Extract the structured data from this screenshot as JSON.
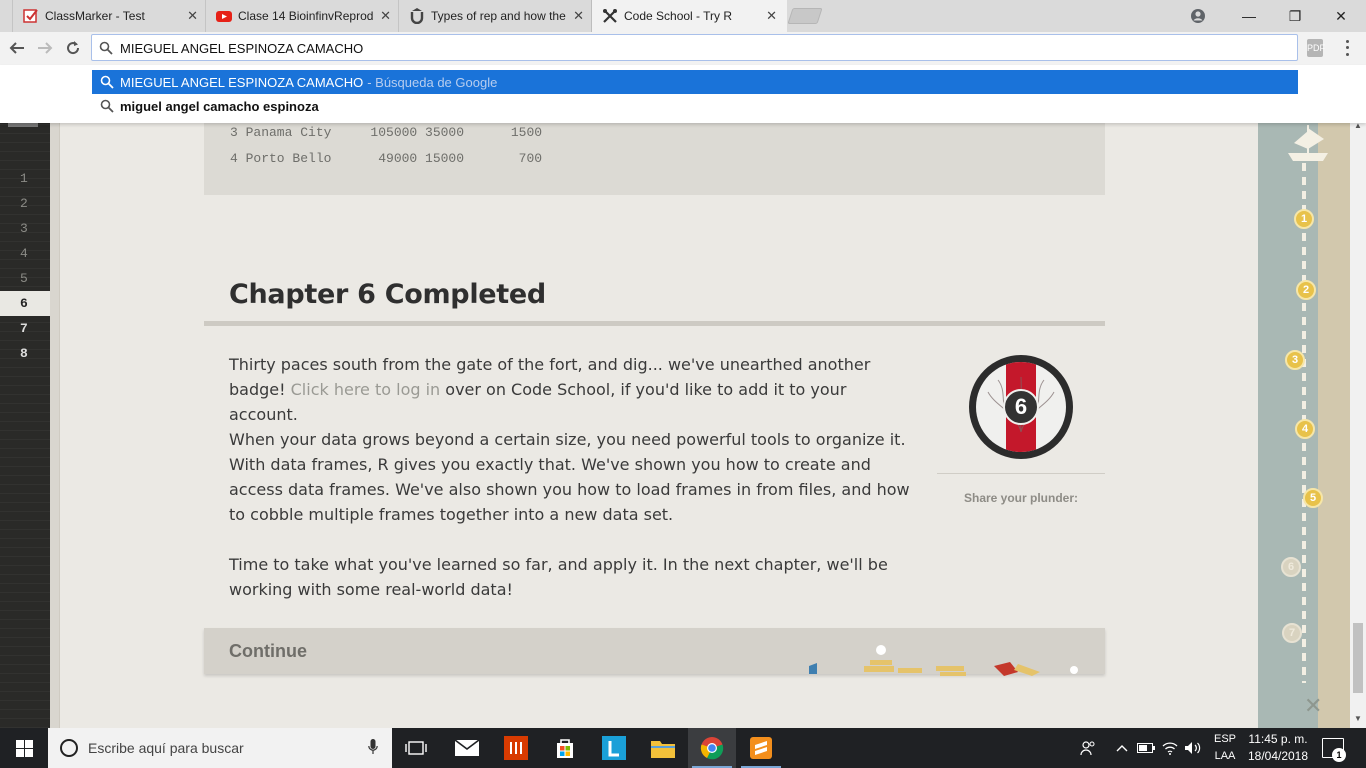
{
  "browser": {
    "tabs": [
      {
        "title": "ClassMarker - Test",
        "icon": "classmarker-icon",
        "active": false
      },
      {
        "title": "Clase 14 BioinfinvReprod",
        "icon": "youtube-icon",
        "active": false
      },
      {
        "title": "Types of rep and how the",
        "icon": "udemy-icon",
        "active": false
      },
      {
        "title": "Code School - Try R",
        "icon": "codeschool-icon",
        "active": true
      }
    ],
    "close_glyph": "✕",
    "address": "MIEGUEL ANGEL ESPINOZA CAMACHO",
    "window_controls": {
      "minimize": "—",
      "restore": "❐",
      "close": "✕"
    },
    "extension_label": "PDF",
    "suggestions": [
      {
        "text": "MIEGUEL ANGEL ESPINOZA CAMACHO",
        "sub": "- Búsqueda de Google",
        "selected": true
      },
      {
        "text": "miguel angel camacho espinoza",
        "sub": "",
        "selected": false
      }
    ]
  },
  "editor": {
    "line_numbers": [
      "1",
      "2",
      "3",
      "4",
      "5",
      "6",
      "7",
      "8"
    ],
    "current_line": "6"
  },
  "code_output": {
    "rows": [
      "3 Panama City     105000 35000      1500",
      "4 Porto Bello      49000 15000       700"
    ]
  },
  "chapter": {
    "title": "Chapter 6 Completed",
    "para1_before": "Thirty paces south from the gate of the fort, and dig... we've unearthed another badge! ",
    "para1_link": "Click here to log in",
    "para1_after": " over on Code School, if you'd like to add it to your account.",
    "para2": "When your data grows beyond a certain size, you need powerful tools to organize it. With data frames, R gives you exactly that. We've shown you how to create and access data frames. We've also shown you how to load frames in from files, and how to cobble multiple frames together into a new data set.",
    "para3": "Time to take what you've learned so far, and apply it. In the next chapter, we'll be working with some real-world data!",
    "badge_number": "6",
    "share_label": "Share your plunder:",
    "continue_label": "Continue"
  },
  "map": {
    "waypoints": [
      "1",
      "2",
      "3",
      "4",
      "5",
      "6",
      "7"
    ],
    "end_mark": "✕"
  },
  "taskbar": {
    "search_placeholder": "Escribe aquí para buscar",
    "lang_top": "ESP",
    "lang_bottom": "LAA",
    "time": "11:45 p. m.",
    "date": "18/04/2018",
    "notification_count": "1"
  },
  "colors": {
    "selected_suggestion": "#1a73d9",
    "badge_red": "#c4182b",
    "waypoint_gold": "#e8c24a"
  }
}
